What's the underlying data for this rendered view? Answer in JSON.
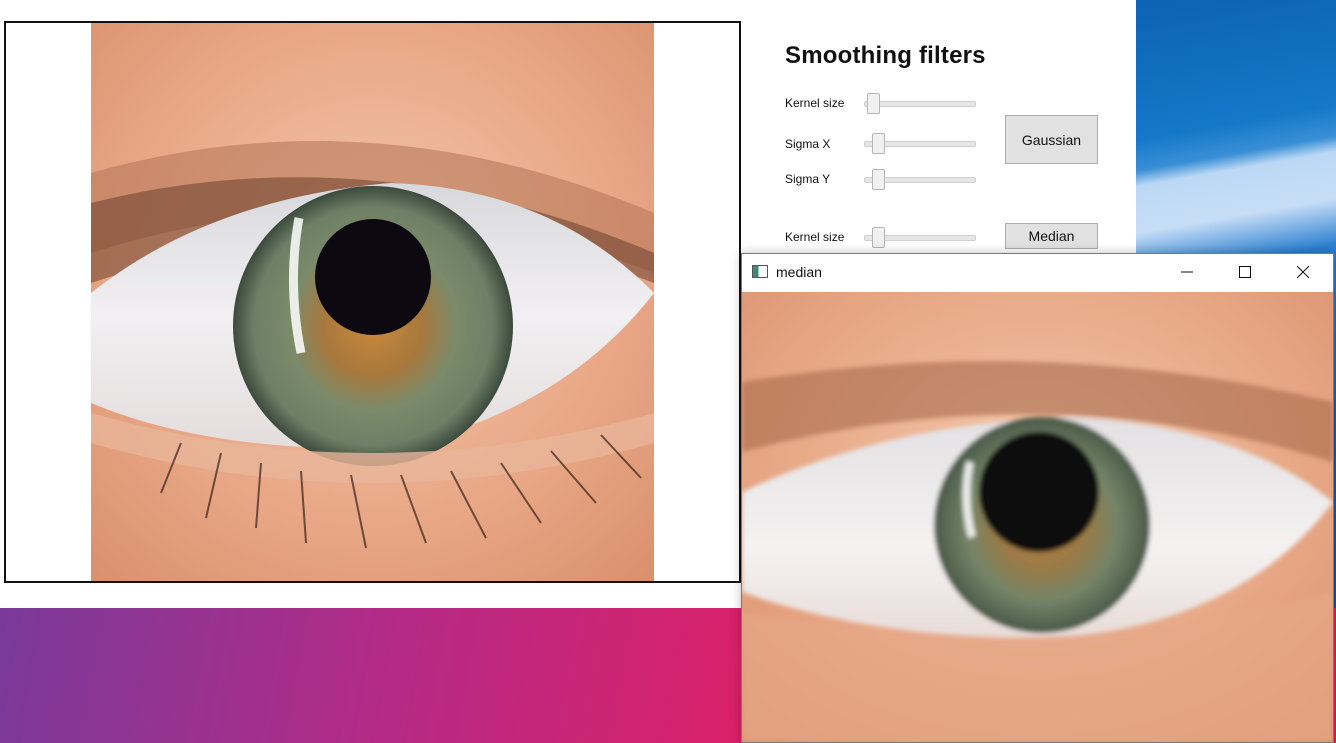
{
  "panel": {
    "title": "Smoothing filters",
    "gaussian": {
      "kernel_label": "Kernel size",
      "sigma_x_label": "Sigma X",
      "sigma_y_label": "Sigma Y",
      "button_label": "Gaussian",
      "kernel_value_fraction": 0.02,
      "sigma_x_value_fraction": 0.06,
      "sigma_y_value_fraction": 0.06
    },
    "median": {
      "kernel_label": "Kernel size",
      "button_label": "Median",
      "kernel_value_fraction": 0.06
    }
  },
  "median_window": {
    "title": "median",
    "controls": [
      "minimize-icon",
      "maximize-icon",
      "close-icon"
    ]
  },
  "colors": {
    "wallpaper_blue": "#1478c8",
    "wallpaper_magenta": "#d9216a",
    "button_face": "#e1e1e1"
  }
}
